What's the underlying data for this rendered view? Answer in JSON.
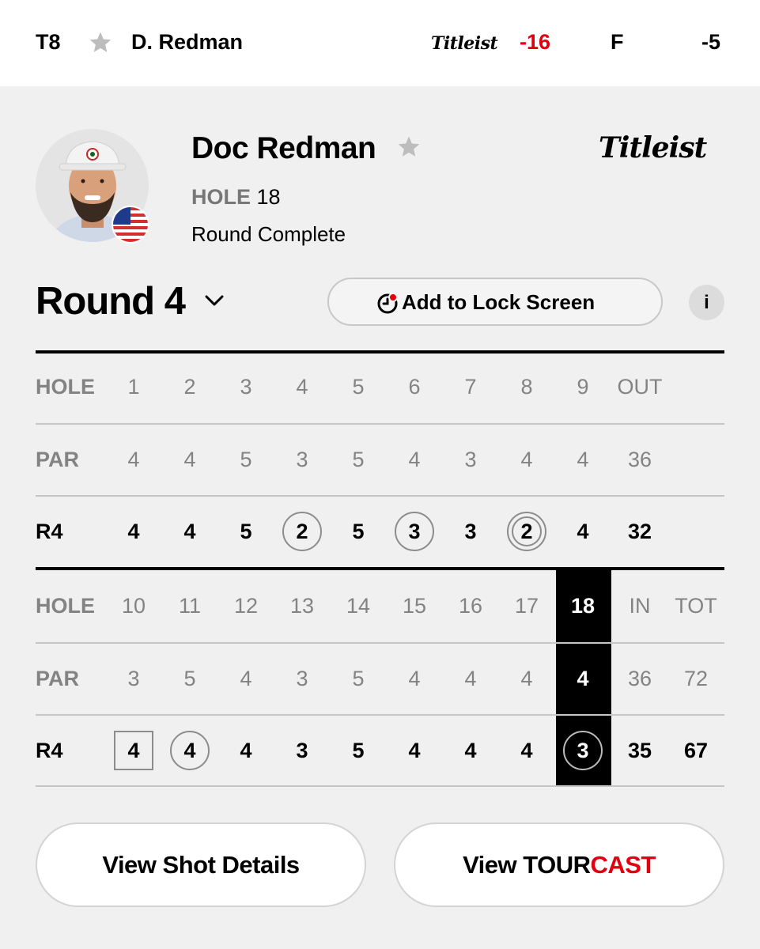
{
  "topbar": {
    "position": "T8",
    "player": "D. Redman",
    "brand": "Titleist",
    "total": "-16",
    "thru": "F",
    "today": "-5"
  },
  "player": {
    "name": "Doc Redman",
    "hole_label": "HOLE",
    "hole_value": "18",
    "status": "Round Complete",
    "brand": "Titleist",
    "country_flag": "us-flag-icon"
  },
  "round": {
    "label": "Round 4",
    "lock_screen_label": "Add to Lock Screen",
    "info_label": "i"
  },
  "scorecard": {
    "front": {
      "hole": {
        "label": "HOLE",
        "cells": [
          "1",
          "2",
          "3",
          "4",
          "5",
          "6",
          "7",
          "8",
          "9",
          "OUT"
        ]
      },
      "par": {
        "label": "PAR",
        "cells": [
          "4",
          "4",
          "5",
          "3",
          "5",
          "4",
          "3",
          "4",
          "4",
          "36"
        ]
      },
      "score": {
        "label": "R4",
        "cells": [
          "4",
          "4",
          "5",
          "2",
          "5",
          "3",
          "3",
          "2",
          "4",
          "32"
        ],
        "marks": [
          "",
          "",
          "",
          "birdie",
          "",
          "birdie",
          "",
          "eagle",
          "",
          ""
        ]
      }
    },
    "back": {
      "hole": {
        "label": "HOLE",
        "cells": [
          "10",
          "11",
          "12",
          "13",
          "14",
          "15",
          "16",
          "17",
          "18",
          "IN",
          "TOT"
        ]
      },
      "par": {
        "label": "PAR",
        "cells": [
          "3",
          "5",
          "4",
          "3",
          "5",
          "4",
          "4",
          "4",
          "4",
          "36",
          "72"
        ]
      },
      "score": {
        "label": "R4",
        "cells": [
          "4",
          "4",
          "4",
          "3",
          "5",
          "4",
          "4",
          "4",
          "3",
          "35",
          "67"
        ],
        "marks": [
          "bogey",
          "birdie",
          "",
          "",
          "",
          "",
          "",
          "",
          "birdie",
          "",
          ""
        ]
      }
    },
    "current_hole": "18"
  },
  "buttons": {
    "shot_details": "View Shot Details",
    "tourcast_prefix": "View ",
    "tourcast_tour": "TOUR",
    "tourcast_cast": "CAST"
  },
  "colors": {
    "accent_red": "#e0000f",
    "background": "#f0f0f0"
  }
}
